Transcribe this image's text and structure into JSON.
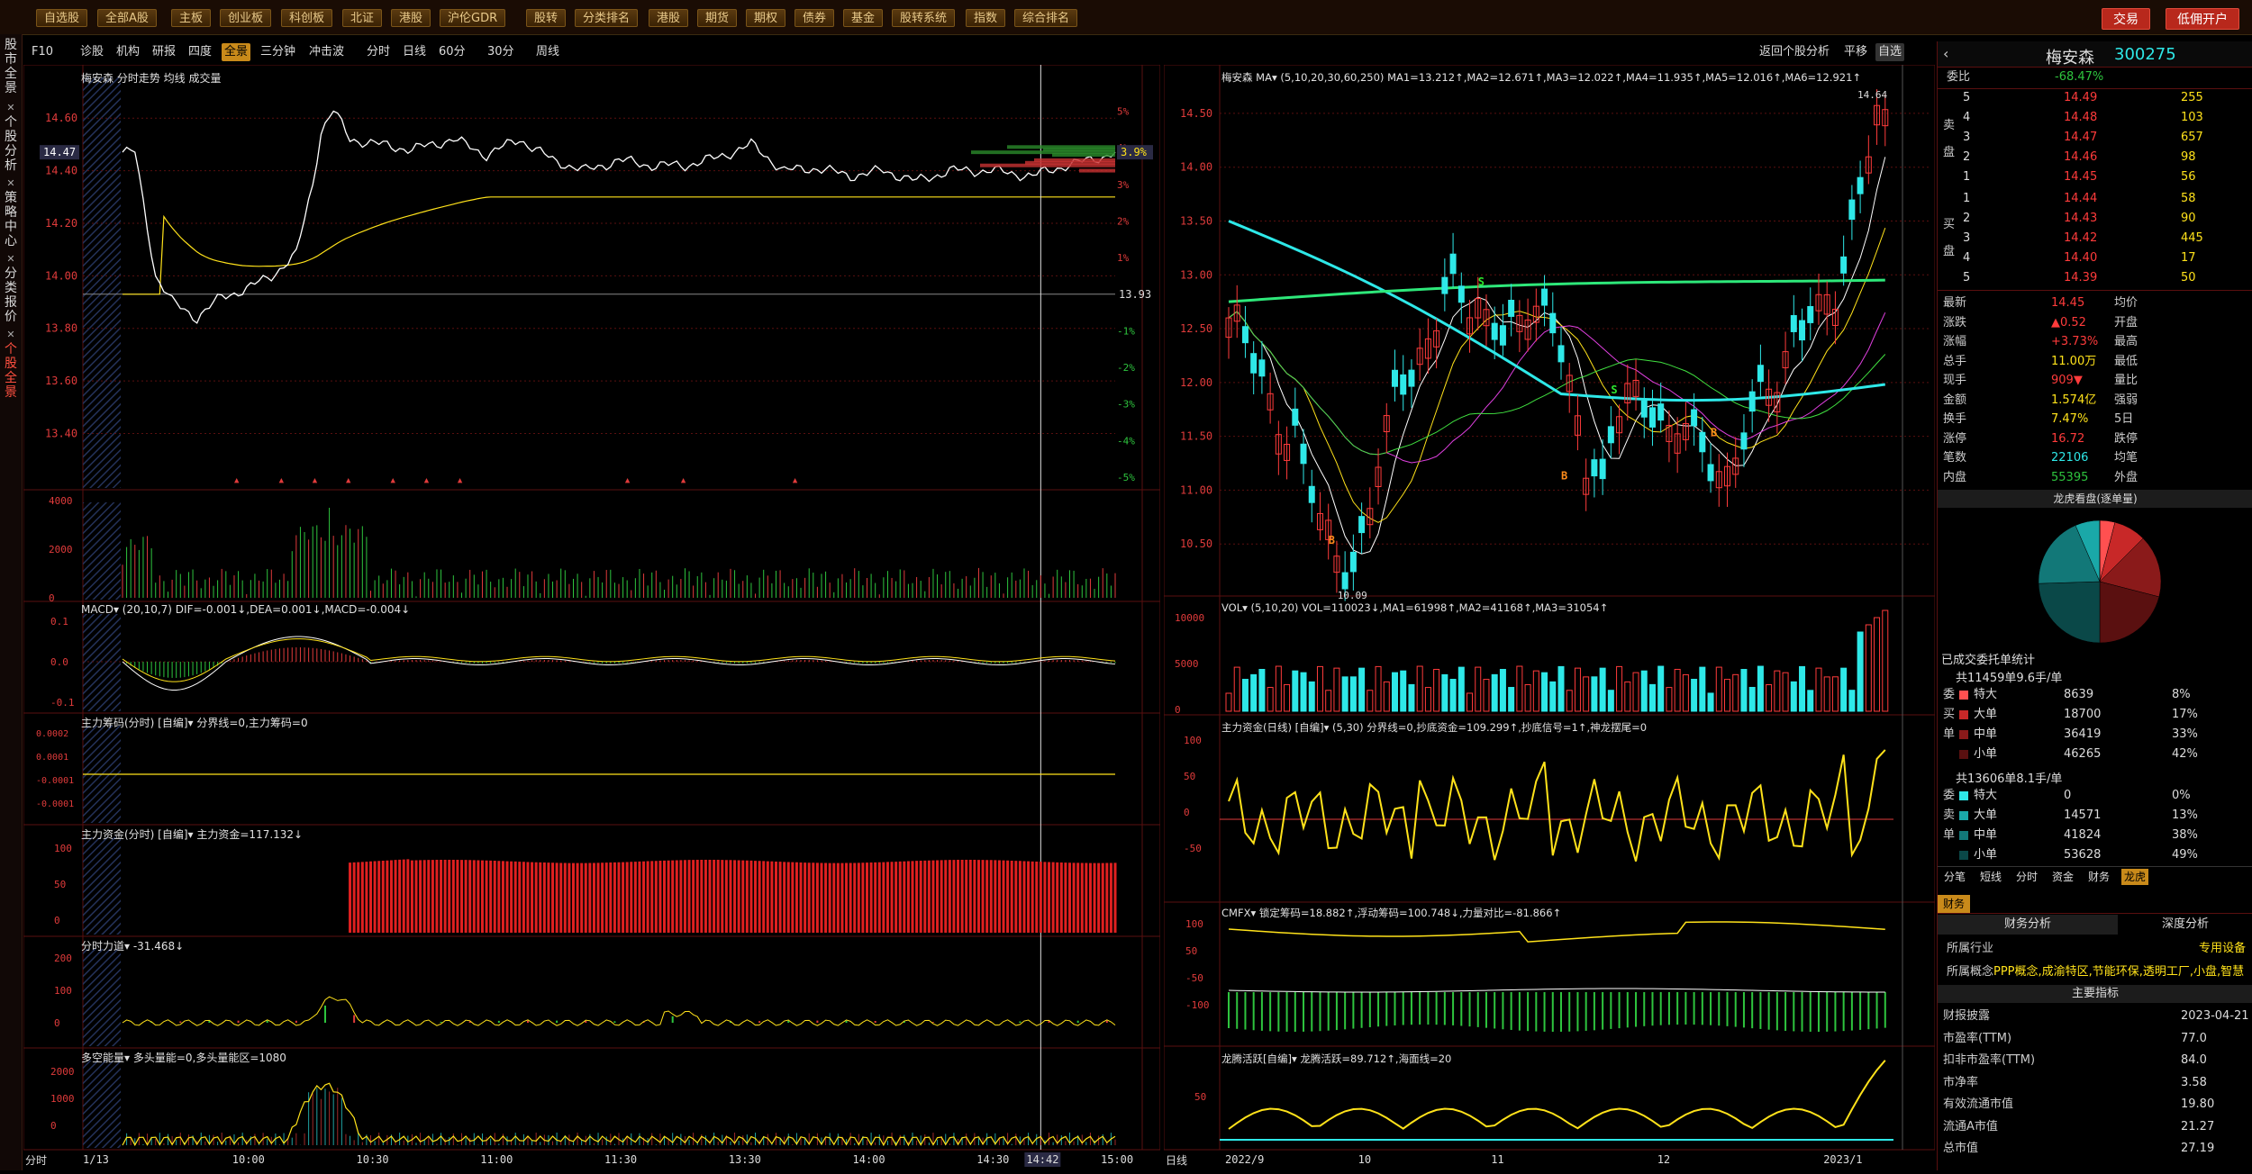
{
  "topbar": {
    "buttons": [
      "自选股",
      "全部A股",
      "主板",
      "创业板",
      "科创板",
      "北证",
      "港股",
      "沪伦GDR",
      "股转",
      "分类排名",
      "港股",
      "期货",
      "期权",
      "债券",
      "基金",
      "股转系统",
      "指数",
      "综合排名"
    ],
    "trade": "交易",
    "open_account": "低佣开户"
  },
  "sidebar": {
    "tabs": [
      "股市全景",
      "个股分析",
      "策略中心",
      "分类报价",
      "个股全景"
    ]
  },
  "toolbar2": {
    "items": [
      "F10",
      "诊股",
      "机构",
      "研报",
      "四度",
      "全景",
      "三分钟",
      "冲击波",
      "分时",
      "日线",
      "60分",
      "30分",
      "周线"
    ],
    "active": "全景",
    "right": [
      "返回个股分析",
      "平移",
      "自选"
    ]
  },
  "intraday": {
    "header": "梅安森  分时走势  均线  成交量",
    "price_label": "14.47",
    "pct_label": "3.9%",
    "ref_price": "13.93",
    "yticks": [
      "14.60",
      "14.40",
      "14.20",
      "14.00",
      "13.80",
      "13.60",
      "13.40"
    ],
    "pct_ticks": [
      "5%",
      "4%",
      "3%",
      "2%",
      "1%",
      "-1%",
      "-2%",
      "-3%",
      "-4%",
      "-5%"
    ],
    "vol_ticks": [
      "4000",
      "2000",
      "0"
    ],
    "macd_hdr": "MACD▾ (20,10,7)  DIF=-0.001↓,DEA=0.001↓,MACD=-0.004↓",
    "macd_ticks": [
      "0.1",
      "0.0",
      "-0.1"
    ],
    "zlcm_hdr": "主力筹码(分时) [自编]▾  分界线=0,主力筹码=0",
    "zlcm_ticks": [
      "0.0002",
      "0.0001",
      "-0.0001",
      "-0.0001"
    ],
    "zlzj_hdr": "主力资金(分时) [自编]▾  主力资金=117.132↓",
    "zlzj_ticks": [
      "100",
      "50",
      "0"
    ],
    "flxd_hdr": "分时力道▾  -31.468↓",
    "flxd_ticks": [
      "200",
      "100",
      "0"
    ],
    "dknl_hdr": "多空能量▾  多头量能=0,多头量能区=1080",
    "dknl_ticks": [
      "2000",
      "1000",
      "0"
    ],
    "time_labels": [
      "1/13",
      "10:00",
      "10:30",
      "11:00",
      "11:30",
      "13:30",
      "14:00",
      "14:30",
      "14:42",
      "15:00"
    ],
    "bottom_left": "分时"
  },
  "kline": {
    "header": "梅安森  MA▾  (5,10,20,30,60,250)  MA1=13.212↑,MA2=12.671↑,MA3=12.022↑,MA4=11.935↑,MA5=12.016↑,MA6=12.921↑",
    "high_label": "14.64",
    "low_label": "10.09",
    "yticks": [
      "14.50",
      "14.00",
      "13.50",
      "13.00",
      "12.50",
      "12.00",
      "11.50",
      "11.00",
      "10.50"
    ],
    "vol_hdr": "VOL▾  (5,10,20)  VOL=110023↓,MA1=61998↑,MA2=41168↑,MA3=31054↑",
    "vol_ticks": [
      "10000",
      "5000",
      "0"
    ],
    "zlzj_hdr": "主力资金(日线) [自编]▾  (5,30)  分界线=0,抄底资金=109.299↑,抄底信号=1↑,神龙摆尾=0",
    "zlzj_ticks": [
      "100",
      "50",
      "0",
      "-50"
    ],
    "cmfx_hdr": "CMFX▾  锁定筹码=18.882↑,浮动筹码=100.748↓,力量对比=-81.866↑",
    "cmfx_ticks": [
      "100",
      "50",
      "-50",
      "-100"
    ],
    "ltly_hdr": "龙腾活跃[自编]▾  龙腾活跃=89.712↑,海面线=20",
    "ltly_ticks": [
      "50"
    ],
    "date_labels": [
      "2022/9",
      "10",
      "11",
      "12",
      "2023/1"
    ],
    "bottom_left": "日线"
  },
  "right": {
    "name": "梅安森",
    "code": "300275",
    "weibi_label": "委比",
    "weibi": "-68.47%",
    "sell": [
      {
        "lv": "5",
        "price": "14.49",
        "vol": "255"
      },
      {
        "lv": "4",
        "price": "14.48",
        "vol": "103"
      },
      {
        "lv": "3",
        "price": "14.47",
        "vol": "657"
      },
      {
        "lv": "2",
        "price": "14.46",
        "vol": "98"
      },
      {
        "lv": "1",
        "price": "14.45",
        "vol": "56"
      }
    ],
    "buy": [
      {
        "lv": "1",
        "price": "14.44",
        "vol": "58"
      },
      {
        "lv": "2",
        "price": "14.43",
        "vol": "90"
      },
      {
        "lv": "3",
        "price": "14.42",
        "vol": "445"
      },
      {
        "lv": "4",
        "price": "14.40",
        "vol": "17"
      },
      {
        "lv": "5",
        "price": "14.39",
        "vol": "50"
      }
    ],
    "sell_side": "卖盘",
    "buy_side": "买盘",
    "stats": [
      {
        "k": "最新",
        "v": "14.45",
        "k2": "均价"
      },
      {
        "k": "涨跌",
        "v": "▲0.52",
        "k2": "开盘"
      },
      {
        "k": "涨幅",
        "v": "+3.73%",
        "k2": "最高"
      },
      {
        "k": "总手",
        "v": "11.00万",
        "k2": "最低"
      },
      {
        "k": "现手",
        "v": "909▼",
        "k2": "量比"
      },
      {
        "k": "金额",
        "v": "1.574亿",
        "k2": "强弱"
      },
      {
        "k": "换手",
        "v": "7.47%",
        "k2": "5日"
      },
      {
        "k": "涨停",
        "v": "16.72",
        "k2": "跌停"
      },
      {
        "k": "笔数",
        "v": "22106",
        "k2": "均笔"
      },
      {
        "k": "内盘",
        "v": "55395",
        "k2": "外盘"
      }
    ],
    "dragon_title": "龙虎看盘(逐单量)",
    "pie_title": "已成交委托单统计",
    "buy_total": "共11459单9.6手/单",
    "buy_rows": [
      {
        "k": "特大",
        "v": "8639",
        "p": "8%"
      },
      {
        "k": "大单",
        "v": "18700",
        "p": "17%"
      },
      {
        "k": "中单",
        "v": "36419",
        "p": "33%"
      },
      {
        "k": "小单",
        "v": "46265",
        "p": "42%"
      }
    ],
    "buy_side_labels": [
      "委",
      "买",
      "单"
    ],
    "sell_total": "共13606单8.1手/单",
    "sell_rows": [
      {
        "k": "特大",
        "v": "0",
        "p": "0%"
      },
      {
        "k": "大单",
        "v": "14571",
        "p": "13%"
      },
      {
        "k": "中单",
        "v": "41824",
        "p": "38%"
      },
      {
        "k": "小单",
        "v": "53628",
        "p": "49%"
      }
    ],
    "sell_side_labels": [
      "委",
      "卖",
      "单"
    ],
    "tabs": [
      "分笔",
      "短线",
      "分时",
      "资金",
      "财务",
      "龙虎"
    ],
    "fin_tab": "财务",
    "fin_sub": [
      "财务分析",
      "深度分析"
    ],
    "industry_label": "所属行业",
    "industry": "专用设备",
    "concept_label": "所属概念",
    "concept": "PPP概念,成渝特区,节能环保,透明工厂,小盘,智慧",
    "main_index": "主要指标",
    "fin_rows": [
      {
        "k": "财报披露",
        "v": "2023-04-21"
      },
      {
        "k": "市盈率(TTM)",
        "v": "77.0"
      },
      {
        "k": "扣非市盈率(TTM)",
        "v": "84.0"
      },
      {
        "k": "市净率",
        "v": "3.58"
      },
      {
        "k": "有效流通市值",
        "v": "19.80"
      },
      {
        "k": "流通A市值",
        "v": "21.27"
      },
      {
        "k": "总市值",
        "v": "27.19"
      }
    ]
  },
  "colors": {
    "up": "#ff3b3b",
    "down": "#2ee8e8",
    "price_line": "#ffffff",
    "avg_line": "#ffe21a",
    "grid": "#5a0f0f"
  }
}
